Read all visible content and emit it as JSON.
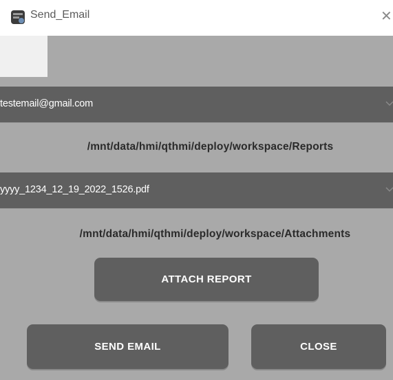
{
  "window": {
    "title": "Send_Email",
    "close_glyph": "✕",
    "icon": "app-icon"
  },
  "email_dropdown": {
    "value": "testemail@gmail.com",
    "icon": "chevron-down-icon"
  },
  "reports_path": "/mnt/data/hmi/qthmi/deploy/workspace/Reports",
  "report_dropdown": {
    "value": "yyyy_1234_12_19_2022_1526.pdf",
    "icon": "chevron-down-icon"
  },
  "attachments_path": "/mnt/data/hmi/qthmi/deploy/workspace/Attachments",
  "buttons": {
    "attach_report": "ATTACH REPORT",
    "send_email": "SEND EMAIL",
    "close": "CLOSE"
  },
  "colors": {
    "background": "#a9a9a9",
    "control": "#5f5f5f",
    "titlebar": "#ffffff",
    "text_dark": "#2a2a2a",
    "text_light": "#ffffff"
  }
}
